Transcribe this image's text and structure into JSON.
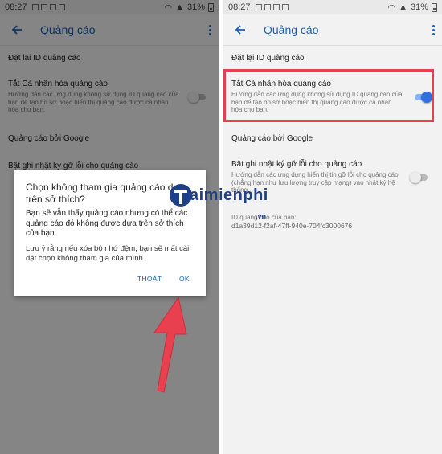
{
  "left_screen": {
    "statusbar": {
      "time": "08:27",
      "battery": "31%"
    },
    "appbar": {
      "title": "Quảng cáo"
    },
    "items": [
      {
        "title": "Đặt lại ID quảng cáo"
      },
      {
        "title": "Tắt Cá nhân hóa quảng cáo",
        "desc": "Hướng dẫn các ứng dụng không sử dụng ID quảng cáo của bạn để tạo hồ sơ hoặc hiển thị quảng cáo được cá nhân hóa cho bạn."
      },
      {
        "title": "Quảng cáo bởi Google"
      },
      {
        "title": "Bật ghi nhật ký gỡ lỗi cho quảng cáo"
      }
    ],
    "dialog": {
      "title": "Chọn không tham gia quảng cáo dựa trên sở thích?",
      "message1": "Bạn sẽ vẫn thấy quảng cáo nhưng có thể các quảng cáo đó không được dựa trên sở thích của bạn.",
      "message2": "Lưu ý rằng nếu xóa bộ nhớ đệm, bạn sẽ mất cài đặt chọn không tham gia của mình.",
      "cancel_label": "THOÁT",
      "ok_label": "OK"
    }
  },
  "right_screen": {
    "statusbar": {
      "time": "08:27",
      "battery": "31%"
    },
    "appbar": {
      "title": "Quảng cáo"
    },
    "items": [
      {
        "title": "Đặt lại ID quảng cáo"
      },
      {
        "title": "Tắt Cá nhân hóa quảng cáo",
        "desc": "Hướng dẫn các ứng dụng không sử dụng ID quảng cáo của bạn để tạo hồ sơ hoặc hiển thị quảng cáo được cá nhân hóa cho bạn.",
        "toggle_on": true
      },
      {
        "title": "Quảng cáo bởi Google"
      },
      {
        "title": "Bật ghi nhật ký gỡ lỗi cho quảng cáo",
        "desc": "Hướng dẫn các ứng dụng hiển thị tin gỡ lỗi cho quảng cáo (chẳng hạn như lưu lượng truy cập mạng) vào nhật ký hệ thống.",
        "toggle_on": false
      }
    ],
    "ad_id": {
      "label": "ID quảng cáo của bạn:",
      "value": "d1a39d12-f2af-47ff-940e-704fc3000676"
    }
  },
  "watermark": {
    "brand_main": "aimienphi",
    "brand_prefix": "T",
    "suffix": ".vn"
  },
  "colors": {
    "accent": "#1a5fb4",
    "highlight": "#e8404f",
    "arrow": "#e8404f",
    "toggle_on": "#2f6fe0"
  }
}
